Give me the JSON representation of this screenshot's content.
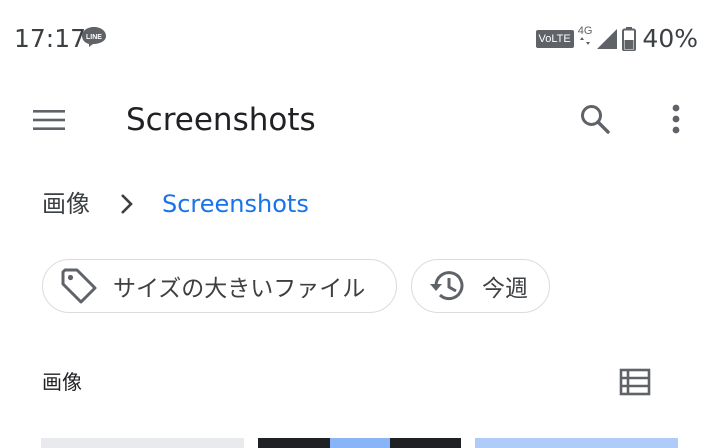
{
  "status_bar": {
    "time": "17:17",
    "notification_icon": "line-app-icon",
    "volte": "VoLTE",
    "network": "4G",
    "battery": "40%"
  },
  "app_bar": {
    "title": "Screenshots",
    "menu_icon": "hamburger-menu-icon",
    "search_icon": "search-icon",
    "more_icon": "more-vert-icon"
  },
  "breadcrumb": {
    "root": "画像",
    "current": "Screenshots"
  },
  "chips": {
    "large_files": "サイズの大きいファイル",
    "this_week": "今週"
  },
  "section": {
    "title": "画像"
  },
  "colors": {
    "accent": "#1a73e8",
    "text": "#202124",
    "secondary_text": "#3c4043",
    "chip_border": "#dadce0"
  }
}
